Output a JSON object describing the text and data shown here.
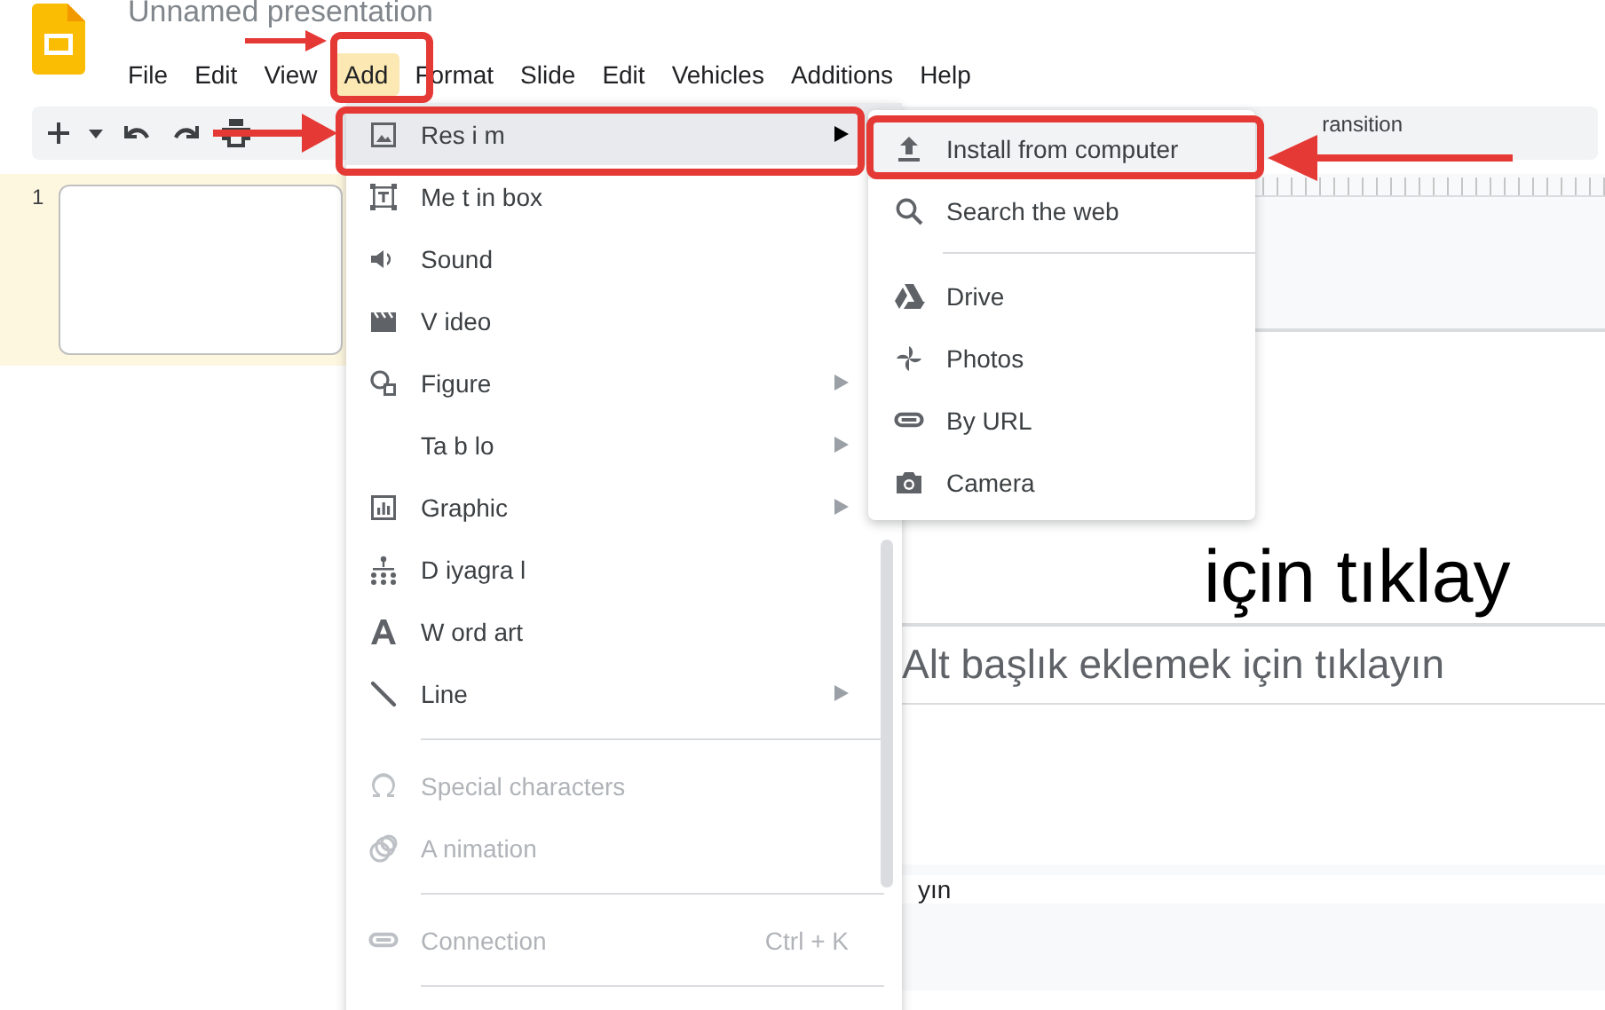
{
  "document": {
    "title": "Unnamed presentation"
  },
  "menu_bar": [
    {
      "label": "File",
      "selected": false
    },
    {
      "label": "Edit",
      "selected": false
    },
    {
      "label": "View",
      "selected": false
    },
    {
      "label": "Add",
      "selected": true
    },
    {
      "label": "Format",
      "selected": false
    },
    {
      "label": "Slide",
      "selected": false
    },
    {
      "label": "Edit",
      "selected": false
    },
    {
      "label": "Vehicles",
      "selected": false
    },
    {
      "label": "Additions",
      "selected": false
    },
    {
      "label": "Help",
      "selected": false
    }
  ],
  "toolbar": {
    "transition_label": "ransition"
  },
  "filmstrip": [
    {
      "number": "1",
      "selected": true
    }
  ],
  "slide": {
    "title": "için tıklay",
    "subtitle": "Alt başlık eklemek için tıklayın"
  },
  "speaker_notes": {
    "text": "yın"
  },
  "add_menu": [
    {
      "kind": "item",
      "label": "Res i m",
      "submenu": true,
      "selected": true,
      "disabled": false
    },
    {
      "kind": "item",
      "label": "Me t in box",
      "submenu": false,
      "selected": false,
      "disabled": false
    },
    {
      "kind": "item",
      "label": "Sound",
      "submenu": false,
      "selected": false,
      "disabled": false
    },
    {
      "kind": "item",
      "label": "V ideo",
      "submenu": false,
      "selected": false,
      "disabled": false
    },
    {
      "kind": "item",
      "label": "Figure",
      "submenu": true,
      "selected": false,
      "disabled": false
    },
    {
      "kind": "item",
      "label": "Ta b lo",
      "submenu": true,
      "selected": false,
      "disabled": false
    },
    {
      "kind": "item",
      "label": "Graphic",
      "submenu": true,
      "selected": false,
      "disabled": false
    },
    {
      "kind": "item",
      "label": "D iyagra l",
      "submenu": false,
      "selected": false,
      "disabled": false
    },
    {
      "kind": "item",
      "label": "W ord art",
      "submenu": false,
      "selected": false,
      "disabled": false
    },
    {
      "kind": "item",
      "label": "Line",
      "submenu": true,
      "selected": false,
      "disabled": false
    },
    {
      "kind": "separator"
    },
    {
      "kind": "item",
      "label": "Special characters",
      "submenu": false,
      "selected": false,
      "disabled": true
    },
    {
      "kind": "item",
      "label": "A nimation",
      "submenu": false,
      "selected": false,
      "disabled": true
    },
    {
      "kind": "separator"
    },
    {
      "kind": "item",
      "label": "Connection",
      "shortcut": "Ctrl + K",
      "submenu": false,
      "selected": false,
      "disabled": true
    },
    {
      "kind": "separator"
    }
  ],
  "image_submenu": [
    {
      "kind": "item",
      "label": "Install from computer",
      "selected": true
    },
    {
      "kind": "item",
      "label": "Search the web",
      "selected": false
    },
    {
      "kind": "separator"
    },
    {
      "kind": "item",
      "label": "Drive",
      "selected": false
    },
    {
      "kind": "item",
      "label": "Photos",
      "selected": false
    },
    {
      "kind": "item",
      "label": "By URL",
      "selected": false
    },
    {
      "kind": "item",
      "label": "Camera",
      "selected": false
    }
  ]
}
